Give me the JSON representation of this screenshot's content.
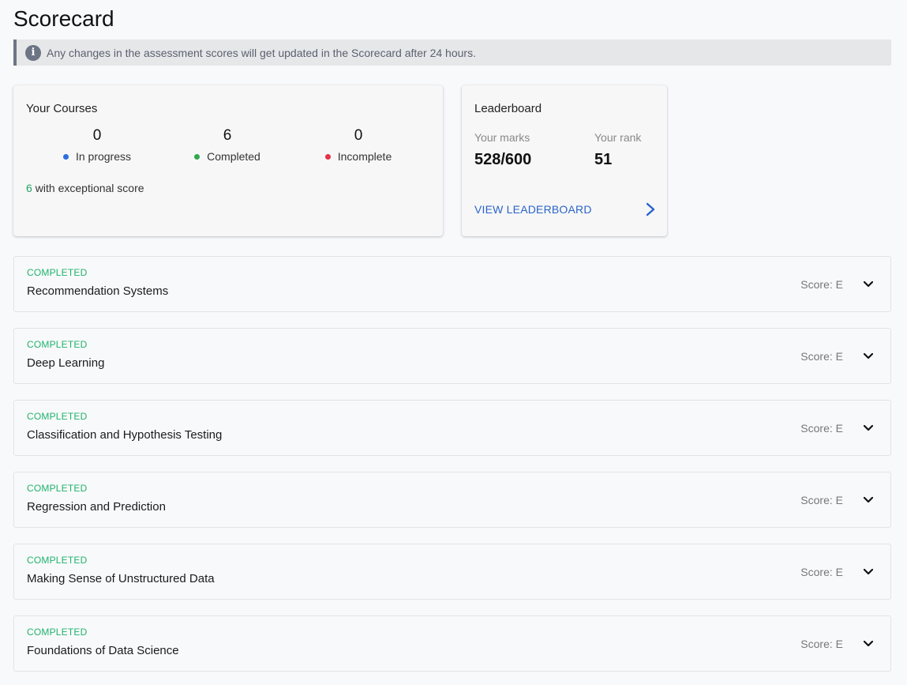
{
  "page": {
    "title": "Scorecard"
  },
  "banner": {
    "icon": "info-icon",
    "text": "Any changes in the assessment scores will get updated in the Scorecard after 24 hours."
  },
  "courses_card": {
    "title": "Your Courses",
    "stats": {
      "in_progress": {
        "value": "0",
        "label": "In progress",
        "color": "#2a6fe0"
      },
      "completed": {
        "value": "6",
        "label": "Completed",
        "color": "#2fa84f"
      },
      "incomplete": {
        "value": "0",
        "label": "Incomplete",
        "color": "#e53146"
      }
    },
    "exceptional": {
      "count": "6",
      "text": "with exceptional score"
    }
  },
  "leaderboard": {
    "title": "Leaderboard",
    "marks_label": "Your marks",
    "marks_value": "528/600",
    "rank_label": "Your rank",
    "rank_value": "51",
    "link_label": "VIEW LEADERBOARD",
    "link_icon": "chevron-right-icon"
  },
  "courses": [
    {
      "status": "COMPLETED",
      "name": "Recommendation Systems",
      "score": "Score: E"
    },
    {
      "status": "COMPLETED",
      "name": "Deep Learning",
      "score": "Score: E"
    },
    {
      "status": "COMPLETED",
      "name": "Classification and Hypothesis Testing",
      "score": "Score: E"
    },
    {
      "status": "COMPLETED",
      "name": "Regression and Prediction",
      "score": "Score: E"
    },
    {
      "status": "COMPLETED",
      "name": "Making Sense of Unstructured Data",
      "score": "Score: E"
    },
    {
      "status": "COMPLETED",
      "name": "Foundations of Data Science",
      "score": "Score: E"
    }
  ],
  "colors": {
    "accent_link": "#2a64c8",
    "status_completed": "#21b36b",
    "banner_bar": "#6d7585"
  }
}
